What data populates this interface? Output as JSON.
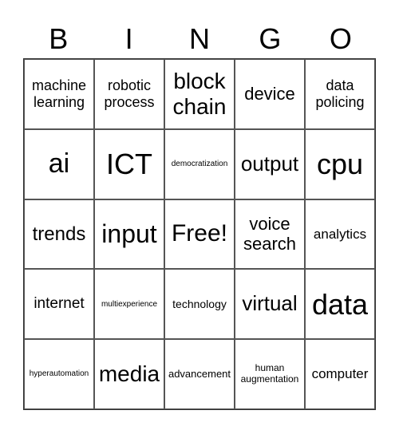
{
  "header": [
    "B",
    "I",
    "N",
    "G",
    "O"
  ],
  "cells": [
    "machine learning",
    "robotic process",
    "block chain",
    "device",
    "data policing",
    "ai",
    "ICT",
    "democratization",
    "output",
    "cpu",
    "trends",
    "input",
    "Free!",
    "voice search",
    "analytics",
    "internet",
    "multiexperience",
    "technology",
    "virtual",
    "data",
    "hyperautomation",
    "media",
    "advancement",
    "human augmentation",
    "computer"
  ]
}
